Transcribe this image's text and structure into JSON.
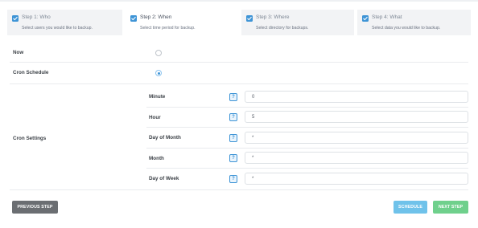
{
  "wizard": {
    "steps": [
      {
        "title": "Step 1: Who",
        "description": "Select users you would like to backup.",
        "checked": true
      },
      {
        "title": "Step 2: When",
        "description": "Select time period for backup.",
        "checked": true,
        "active": true
      },
      {
        "title": "Step 3: Where",
        "description": "Select directory for backups.",
        "checked": true
      },
      {
        "title": "Step 4: What",
        "description": "Select data you would like to backup.",
        "checked": true
      }
    ]
  },
  "form": {
    "now_label": "Now",
    "cron_schedule_label": "Cron Schedule",
    "cron_settings_label": "Cron Settings",
    "selected_option": "Cron Schedule",
    "help_icon_text": "?",
    "fields": [
      {
        "label": "Minute",
        "value": "0"
      },
      {
        "label": "Hour",
        "value": "5"
      },
      {
        "label": "Day of Month",
        "value": "*"
      },
      {
        "label": "Month",
        "value": "*"
      },
      {
        "label": "Day of Week",
        "value": "*"
      }
    ]
  },
  "buttons": {
    "previous": "PREVIOUS STEP",
    "schedule": "SCHEDULE",
    "next": "NEXT STEP"
  },
  "colors": {
    "accent": "#3e94d6",
    "previous_button": "#6b6e72",
    "schedule_button": "#6fc2ea",
    "next_button": "#6fd08c"
  }
}
